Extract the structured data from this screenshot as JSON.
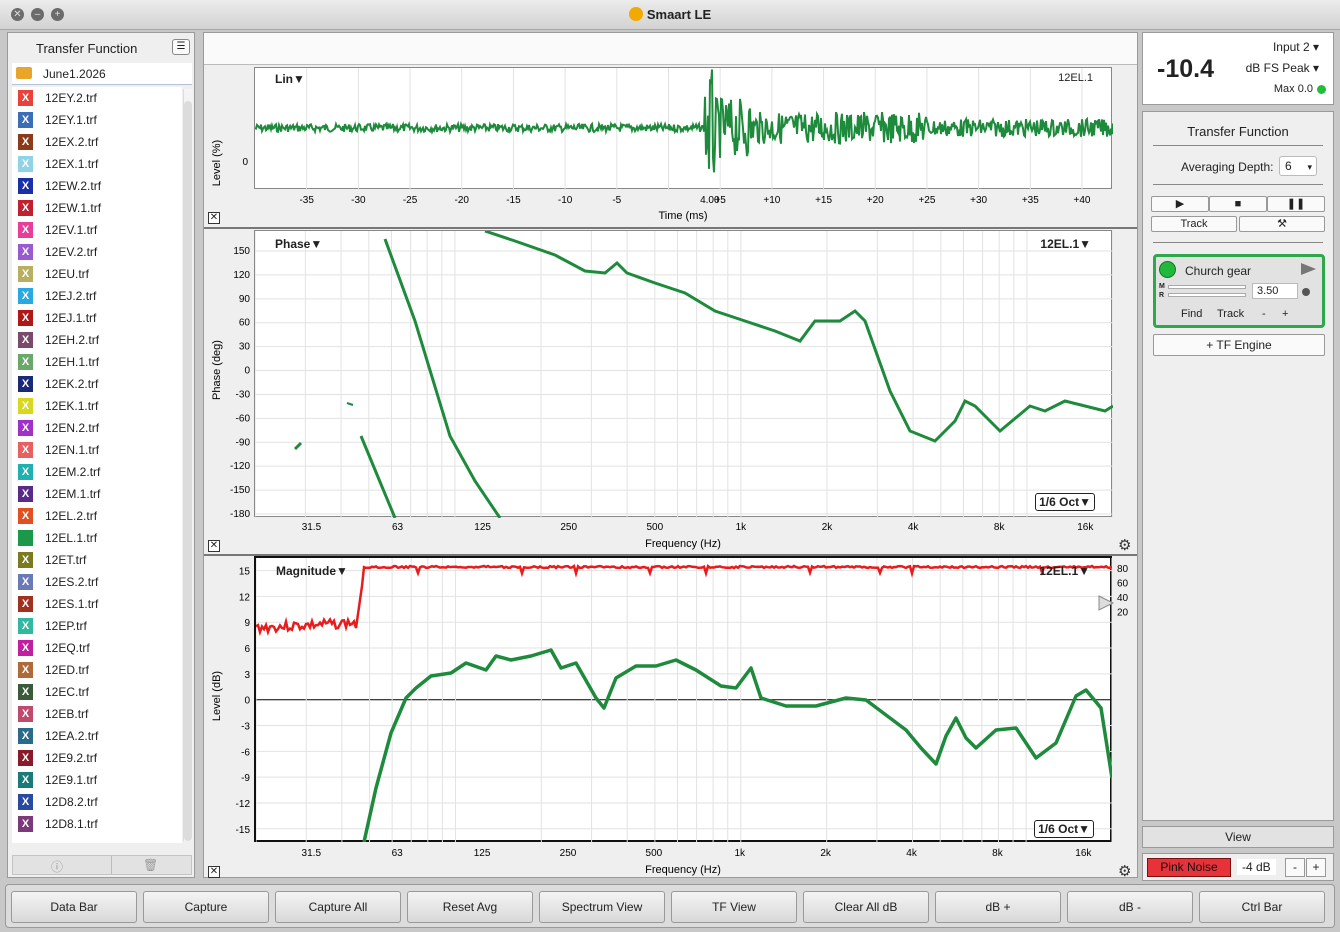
{
  "window": {
    "title": "Smaart LE"
  },
  "left_panel": {
    "title": "Transfer Function",
    "folder": "June1.2026",
    "files": [
      {
        "name": "12EY.2.trf",
        "color": "#e8423a"
      },
      {
        "name": "12EY.1.trf",
        "color": "#3a6fb8"
      },
      {
        "name": "12EX.2.trf",
        "color": "#8b3a1a"
      },
      {
        "name": "12EX.1.trf",
        "color": "#8ed4e6"
      },
      {
        "name": "12EW.2.trf",
        "color": "#1a2fa8"
      },
      {
        "name": "12EW.1.trf",
        "color": "#c02030"
      },
      {
        "name": "12EV.1.trf",
        "color": "#e83e9a"
      },
      {
        "name": "12EV.2.trf",
        "color": "#9a5ad0"
      },
      {
        "name": "12EU.trf",
        "color": "#b8b060"
      },
      {
        "name": "12EJ.2.trf",
        "color": "#2aa8e0"
      },
      {
        "name": "12EJ.1.trf",
        "color": "#b01818"
      },
      {
        "name": "12EH.2.trf",
        "color": "#7a4a6a"
      },
      {
        "name": "12EH.1.trf",
        "color": "#6aa86a"
      },
      {
        "name": "12EK.2.trf",
        "color": "#1a2a78"
      },
      {
        "name": "12EK.1.trf",
        "color": "#d8d820"
      },
      {
        "name": "12EN.2.trf",
        "color": "#a030c8"
      },
      {
        "name": "12EN.1.trf",
        "color": "#e86060"
      },
      {
        "name": "12EM.2.trf",
        "color": "#20b0b0"
      },
      {
        "name": "12EM.1.trf",
        "color": "#5a2a8a"
      },
      {
        "name": "12EL.2.trf",
        "color": "#e05020"
      },
      {
        "name": "12EL.1.trf",
        "color": "#1a9a48",
        "plain": true
      },
      {
        "name": "12ET.trf",
        "color": "#7a7a20"
      },
      {
        "name": "12ES.2.trf",
        "color": "#6a7ab8"
      },
      {
        "name": "12ES.1.trf",
        "color": "#a03020"
      },
      {
        "name": "12EP.trf",
        "color": "#30b8a0"
      },
      {
        "name": "12EQ.trf",
        "color": "#c020a0"
      },
      {
        "name": "12ED.trf",
        "color": "#b06a3a"
      },
      {
        "name": "12EC.trf",
        "color": "#3a5a3a"
      },
      {
        "name": "12EB.trf",
        "color": "#c04a6a"
      },
      {
        "name": "12EA.2.trf",
        "color": "#2a6a8a"
      },
      {
        "name": "12E9.2.trf",
        "color": "#8a1a2a"
      },
      {
        "name": "12E9.1.trf",
        "color": "#1a7a7a"
      },
      {
        "name": "12D8.2.trf",
        "color": "#2a4aa0"
      },
      {
        "name": "12D8.1.trf",
        "color": "#7a3a7a"
      }
    ]
  },
  "center": {
    "time_plot": {
      "menu": "Lin▼",
      "trace": "12EL.1",
      "ylabel": "Level (%)",
      "xlabel": "Time (ms)",
      "yticks": [
        "0"
      ],
      "xticks": [
        "-35",
        "-30",
        "-25",
        "-20",
        "-15",
        "-10",
        "-5",
        "4.00",
        "+5",
        "+10",
        "+15",
        "+20",
        "+25",
        "+30",
        "+35",
        "+40"
      ]
    },
    "phase_plot": {
      "menu": "Phase▼",
      "trace": "12EL.1▼",
      "ylabel": "Phase (deg)",
      "xlabel": "Frequency (Hz)",
      "smoothing": "1/6 Oct▼",
      "yticks": [
        "150",
        "120",
        "90",
        "60",
        "30",
        "0",
        "-30",
        "-60",
        "-90",
        "-120",
        "-150",
        "-180"
      ],
      "xticks": [
        "31.5",
        "63",
        "125",
        "250",
        "500",
        "1k",
        "2k",
        "4k",
        "8k",
        "16k"
      ]
    },
    "mag_plot": {
      "menu": "Magnitude▼",
      "trace": "12EL.1▼",
      "ylabel": "Level (dB)",
      "xlabel": "Frequency (Hz)",
      "smoothing": "1/6 Oct▼",
      "yticks": [
        "15",
        "12",
        "9",
        "6",
        "3",
        "0",
        "-3",
        "-6",
        "-9",
        "-12",
        "-15"
      ],
      "coh_ticks": [
        "80",
        "60",
        "40",
        "20"
      ],
      "xticks": [
        "31.5",
        "63",
        "125",
        "250",
        "500",
        "1k",
        "2k",
        "4k",
        "8k",
        "16k"
      ]
    }
  },
  "right_panel": {
    "meter": {
      "value": "-10.4",
      "input": "Input 2",
      "mode": "dB FS Peak",
      "max": "Max 0.0"
    },
    "tf_title": "Transfer Function",
    "averaging_label": "Averaging Depth:",
    "averaging_value": "6",
    "track_label": "Track",
    "measurement": {
      "name": "Church gear",
      "delay": "3.50",
      "find": "Find",
      "track": "Track",
      "minus": "-",
      "plus": "+",
      "m": "M",
      "r": "R"
    },
    "tf_engine": "+ TF Engine",
    "view": "View",
    "pink_noise": "Pink Noise",
    "pink_level": "-4 dB",
    "minus": "-",
    "plus": "+"
  },
  "bottom_bar": [
    "Data Bar",
    "Capture",
    "Capture All",
    "Reset Avg",
    "Spectrum View",
    "TF View",
    "Clear All dB",
    "dB +",
    "dB -",
    "Ctrl Bar"
  ],
  "colors": {
    "trace_green": "#1e8a3c",
    "coherence_red": "#e81c1c",
    "meter_ok": "#1fbf3c"
  }
}
